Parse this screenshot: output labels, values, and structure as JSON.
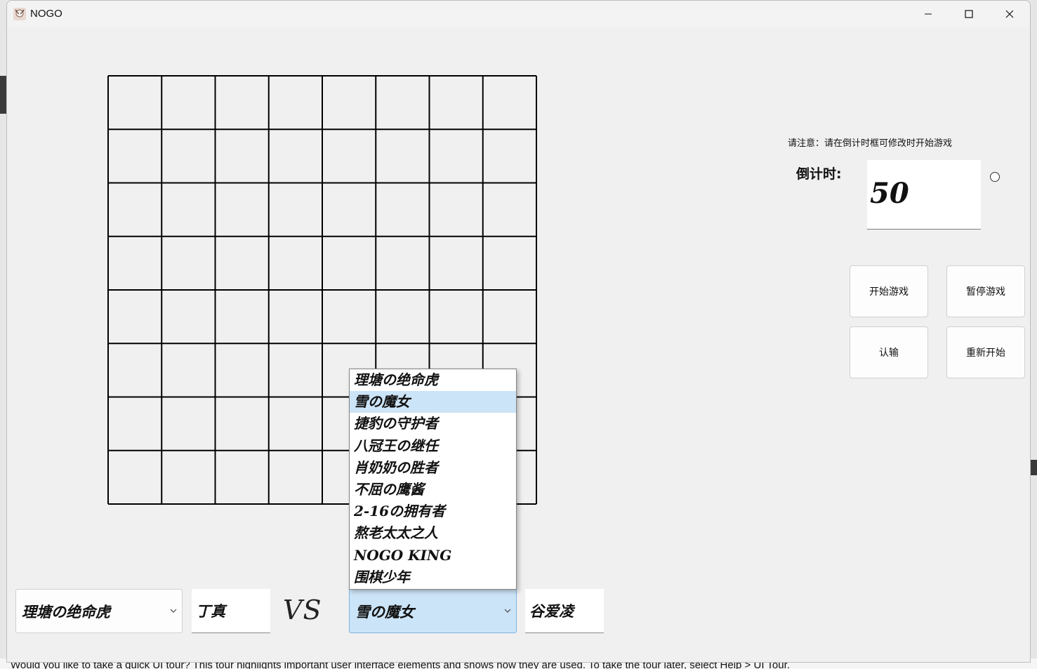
{
  "window": {
    "title": "NOGO",
    "controls": [
      "minimize-icon",
      "maximize-icon",
      "close-icon"
    ]
  },
  "board": {
    "rows": 8,
    "cols": 8
  },
  "notice": "请注意：请在倒计时框可修改时开始游戏",
  "countdown": {
    "label": "倒计时:",
    "value": "50"
  },
  "buttons": {
    "start": "开始游戏",
    "pause": "暂停游戏",
    "resign": "认输",
    "restart": "重新开始"
  },
  "players": {
    "left_title": "理塘の绝命虎",
    "left_name": "丁真",
    "vs": "VS",
    "right_title": "雪の魔女",
    "right_name": "谷爱凌"
  },
  "dropdown": {
    "items": [
      "理塘の绝命虎",
      "雪の魔女",
      "捷豹の守护者",
      "八冠王の继任",
      "肖奶奶の胜者",
      "不屈の鹰酱",
      "2-16の拥有者",
      "熬老太太之人",
      "NOGO KING",
      "围棋少年"
    ],
    "selected_index": 1
  },
  "banner": "Would you like to take a quick UI tour? This tour highlights important user interface elements and shows how they are used. To take the tour later, select Help > UI Tour."
}
